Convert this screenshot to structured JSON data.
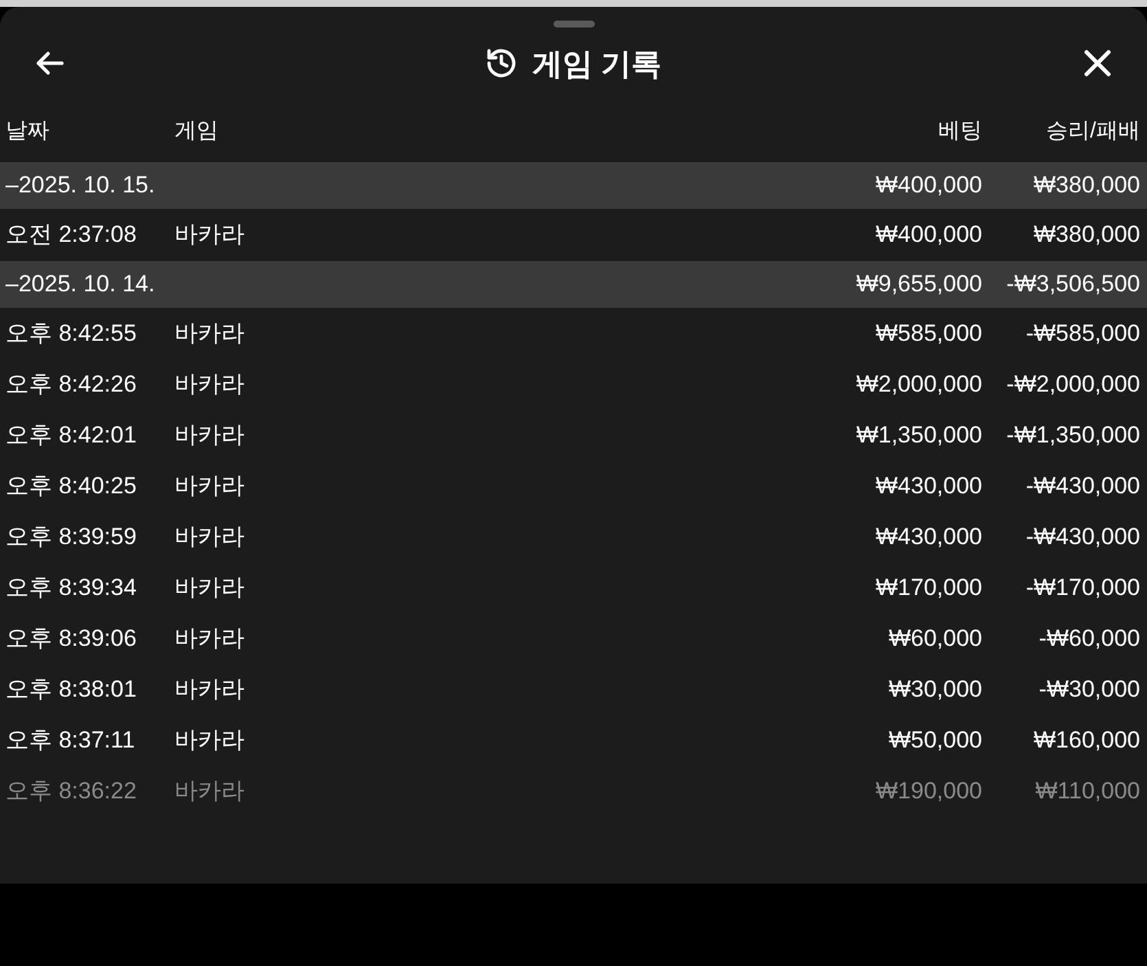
{
  "header": {
    "title": "게임 기록"
  },
  "table": {
    "columns": [
      "날짜",
      "게임",
      "베팅",
      "승리/패배"
    ],
    "rows": [
      {
        "kind": "group",
        "date": "–2025. 10. 15.",
        "bet": "₩400,000",
        "result": "₩380,000",
        "dimmed": false
      },
      {
        "kind": "entry",
        "date": "오전 2:37:08",
        "game": "바카라",
        "bet": "₩400,000",
        "result": "₩380,000",
        "dimmed": false
      },
      {
        "kind": "group",
        "date": "–2025. 10. 14.",
        "bet": "₩9,655,000",
        "result": "-₩3,506,500",
        "dimmed": false
      },
      {
        "kind": "entry",
        "date": "오후 8:42:55",
        "game": "바카라",
        "bet": "₩585,000",
        "result": "-₩585,000",
        "dimmed": false
      },
      {
        "kind": "entry",
        "date": "오후 8:42:26",
        "game": "바카라",
        "bet": "₩2,000,000",
        "result": "-₩2,000,000",
        "dimmed": false
      },
      {
        "kind": "entry",
        "date": "오후 8:42:01",
        "game": "바카라",
        "bet": "₩1,350,000",
        "result": "-₩1,350,000",
        "dimmed": false
      },
      {
        "kind": "entry",
        "date": "오후 8:40:25",
        "game": "바카라",
        "bet": "₩430,000",
        "result": "-₩430,000",
        "dimmed": false
      },
      {
        "kind": "entry",
        "date": "오후 8:39:59",
        "game": "바카라",
        "bet": "₩430,000",
        "result": "-₩430,000",
        "dimmed": false
      },
      {
        "kind": "entry",
        "date": "오후 8:39:34",
        "game": "바카라",
        "bet": "₩170,000",
        "result": "-₩170,000",
        "dimmed": false
      },
      {
        "kind": "entry",
        "date": "오후 8:39:06",
        "game": "바카라",
        "bet": "₩60,000",
        "result": "-₩60,000",
        "dimmed": false
      },
      {
        "kind": "entry",
        "date": "오후 8:38:01",
        "game": "바카라",
        "bet": "₩30,000",
        "result": "-₩30,000",
        "dimmed": false
      },
      {
        "kind": "entry",
        "date": "오후 8:37:11",
        "game": "바카라",
        "bet": "₩50,000",
        "result": "₩160,000",
        "dimmed": false
      },
      {
        "kind": "entry",
        "date": "오후 8:36:22",
        "game": "바카라",
        "bet": "₩190,000",
        "result": "₩110,000",
        "dimmed": true
      }
    ]
  }
}
